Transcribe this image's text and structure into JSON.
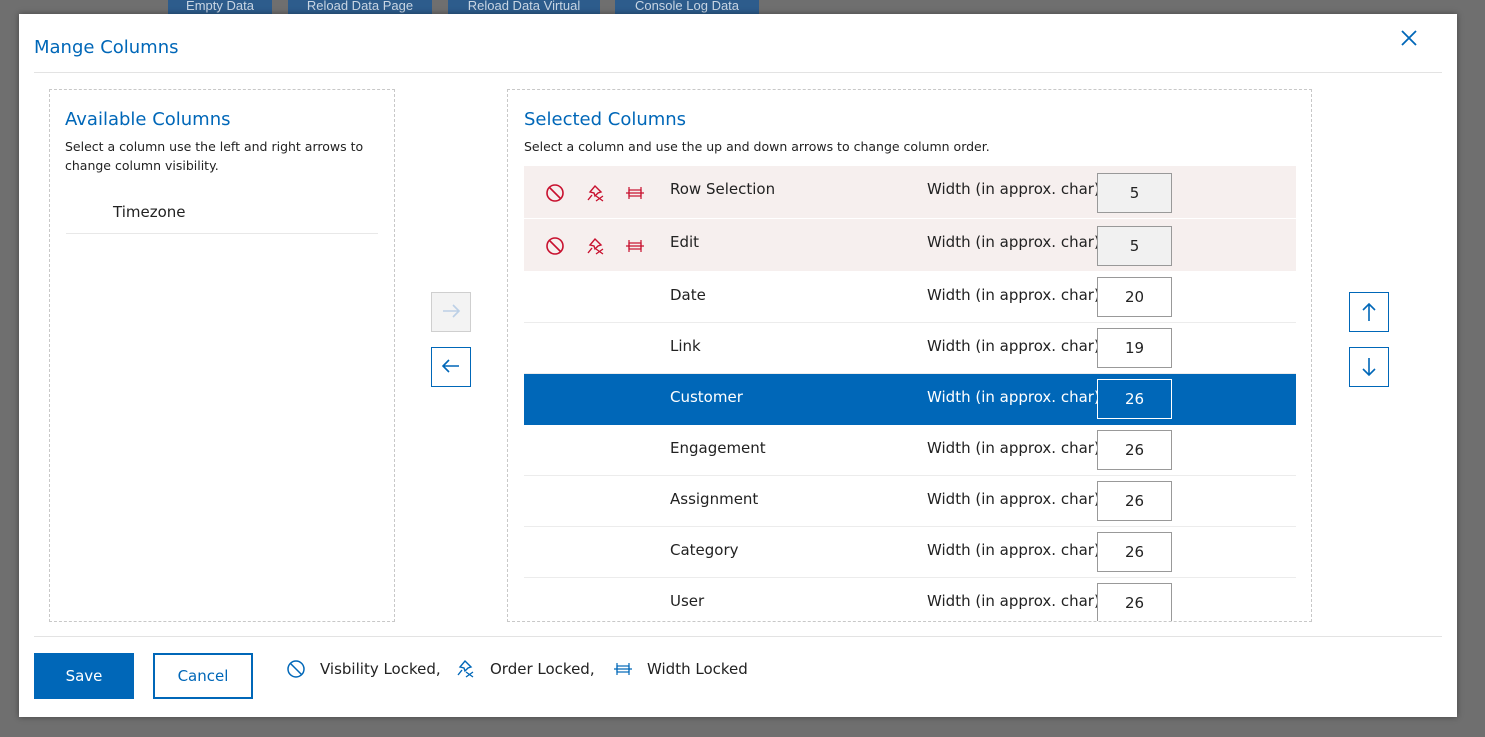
{
  "background_toolbar": {
    "buttons": [
      "Empty Data",
      "Reload Data Page",
      "Reload Data Virtual",
      "Console Log Data"
    ]
  },
  "dialog": {
    "title": "Mange Columns",
    "close_icon": "close-icon"
  },
  "available": {
    "title": "Available Columns",
    "description": "Select a column use the left and right arrows to change column visibility.",
    "items": [
      "Timezone"
    ]
  },
  "selected": {
    "title": "Selected Columns",
    "description": "Select a column and use the up and down arrows to change column order.",
    "width_label": "Width (in approx. char)",
    "rows": [
      {
        "name": "Row Selection",
        "width": "5",
        "locked": true,
        "selected": false
      },
      {
        "name": "Edit",
        "width": "5",
        "locked": true,
        "selected": false
      },
      {
        "name": "Date",
        "width": "20",
        "locked": false,
        "selected": false
      },
      {
        "name": "Link",
        "width": "19",
        "locked": false,
        "selected": false
      },
      {
        "name": "Customer",
        "width": "26",
        "locked": false,
        "selected": true
      },
      {
        "name": "Engagement",
        "width": "26",
        "locked": false,
        "selected": false
      },
      {
        "name": "Assignment",
        "width": "26",
        "locked": false,
        "selected": false
      },
      {
        "name": "Category",
        "width": "26",
        "locked": false,
        "selected": false
      },
      {
        "name": "User",
        "width": "26",
        "locked": false,
        "selected": false
      }
    ]
  },
  "move_buttons": {
    "right": {
      "icon": "arrow-right-icon",
      "disabled": true
    },
    "left": {
      "icon": "arrow-left-icon",
      "disabled": false
    },
    "up": {
      "icon": "arrow-up-icon"
    },
    "down": {
      "icon": "arrow-down-icon"
    }
  },
  "footer": {
    "save_label": "Save",
    "cancel_label": "Cancel",
    "legend": {
      "visibility": "Visbility Locked,",
      "order": "Order Locked,",
      "width": "Width Locked"
    }
  },
  "colors": {
    "accent": "#0067b8",
    "lock_icon": "#c8102e",
    "locked_row_bg": "#f6efee"
  }
}
